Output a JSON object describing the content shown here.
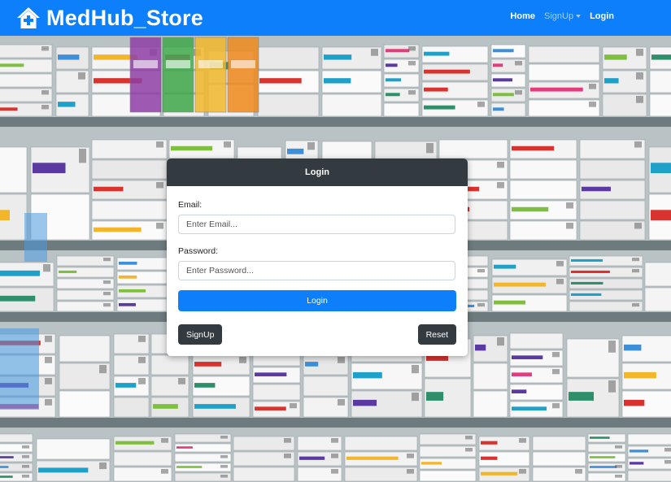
{
  "navbar": {
    "brand": "MedHub_Store",
    "brand_icon": "house-medical-icon",
    "links": {
      "home": "Home",
      "signup": "SignUp",
      "login": "Login"
    }
  },
  "login_card": {
    "title": "Login",
    "email_label": "Email:",
    "email_placeholder": "Enter Email...",
    "email_value": "",
    "password_label": "Password:",
    "password_placeholder": "Enter Password...",
    "password_value": "",
    "login_button": "Login",
    "signup_button": "SignUp",
    "reset_button": "Reset"
  },
  "colors": {
    "primary": "#0d7ffb",
    "dark": "#333a40",
    "card_bg": "#ffffff"
  }
}
